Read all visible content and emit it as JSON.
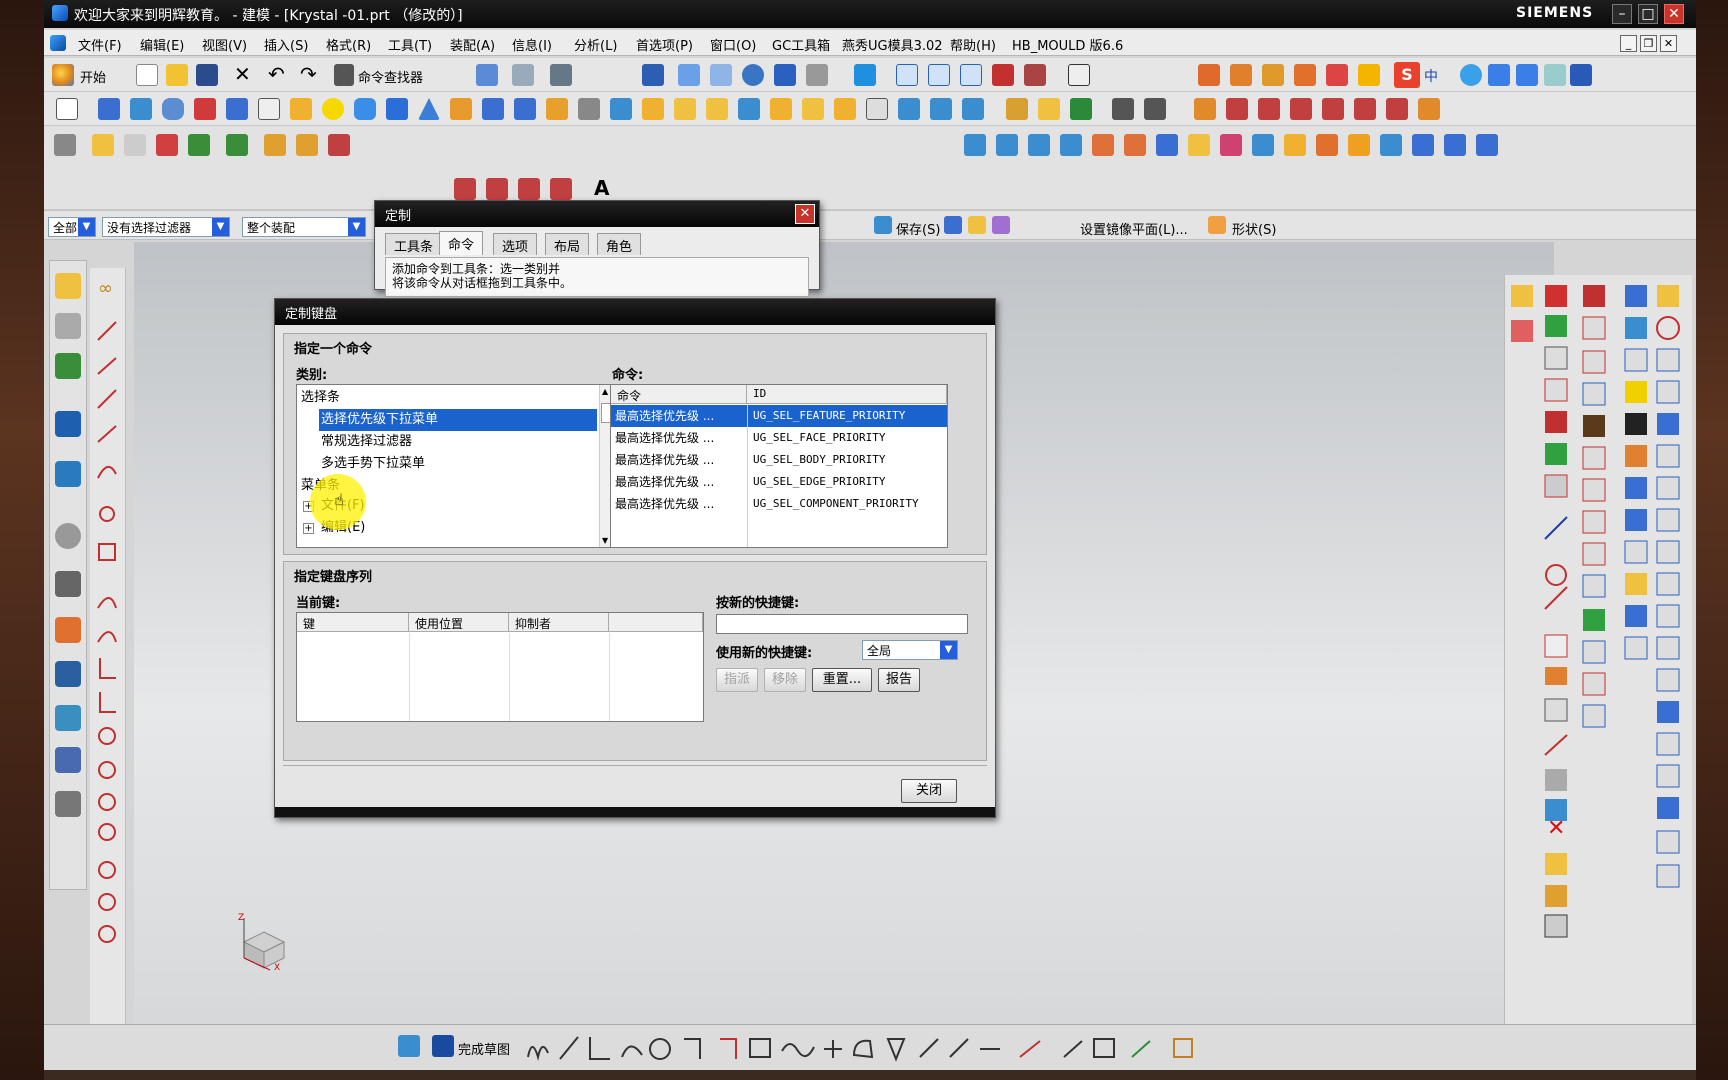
{
  "window": {
    "title": "欢迎大家来到明辉教育。 - 建模 - [Krystal -01.prt （修改的）]",
    "brand": "SIEMENS",
    "minimize": "–",
    "maximize": "□",
    "close": "✕"
  },
  "menubar": {
    "items": [
      "文件(F)",
      "编辑(E)",
      "视图(V)",
      "插入(S)",
      "格式(R)",
      "工具(T)",
      "装配(A)",
      "信息(I)",
      "分析(L)",
      "首选项(P)",
      "窗口(O)",
      "GC工具箱",
      "燕秀UG模具3.02",
      "帮助(H)",
      "HB_MOULD 版6.6"
    ]
  },
  "toolbar": {
    "start_label": "开始",
    "command_finder_label": "命令查找器"
  },
  "selection_bar": {
    "filter1": "全部",
    "filter2": "没有选择过滤器",
    "filter3": "整个装配",
    "save_label": "保存(S)",
    "mirror_plane_label": "设置镜像平面(L)...",
    "shape_label": "形状(S)"
  },
  "customize_dialog": {
    "title": "定制",
    "tabs": [
      "工具条",
      "命令",
      "选项",
      "布局",
      "角色"
    ],
    "active_tab": "命令",
    "hint_line1": "添加命令到工具条：选一类别并",
    "hint_line2": "将该命令从对话框拖到工具条中。"
  },
  "keyboard_dialog": {
    "title": "定制键盘",
    "section1_title": "指定一个命令",
    "category_label": "类别:",
    "category_items": [
      {
        "text": "选择条",
        "indent": 0,
        "selected": false
      },
      {
        "text": "选择优先级下拉菜单",
        "indent": 1,
        "selected": true
      },
      {
        "text": "常规选择过滤器",
        "indent": 1,
        "selected": false
      },
      {
        "text": "多选手势下拉菜单",
        "indent": 1,
        "selected": false
      },
      {
        "text": "菜单条",
        "indent": 0,
        "selected": false
      },
      {
        "text": "文件(F)",
        "indent": 1,
        "selected": false,
        "expander": "+"
      },
      {
        "text": "编辑(E)",
        "indent": 1,
        "selected": false,
        "expander": "+"
      }
    ],
    "commands_label": "命令:",
    "commands_columns": [
      "命令",
      "ID"
    ],
    "commands": [
      {
        "name": "最高选择优先级 ...",
        "id": "UG_SEL_FEATURE_PRIORITY",
        "selected": true
      },
      {
        "name": "最高选择优先级 ...",
        "id": "UG_SEL_FACE_PRIORITY",
        "selected": false
      },
      {
        "name": "最高选择优先级 ...",
        "id": "UG_SEL_BODY_PRIORITY",
        "selected": false
      },
      {
        "name": "最高选择优先级 ...",
        "id": "UG_SEL_EDGE_PRIORITY",
        "selected": false
      },
      {
        "name": "最高选择优先级 ...",
        "id": "UG_SEL_COMPONENT_PRIORITY",
        "selected": false
      }
    ],
    "section2_title": "指定键盘序列",
    "current_keys_label": "当前键:",
    "keys_columns": [
      "键",
      "使用位置",
      "抑制者"
    ],
    "new_shortcut_label": "按新的快捷键:",
    "new_shortcut_value": "",
    "use_shortcut_label": "使用新的快捷键:",
    "scope_value": "全局",
    "assign_button": "指派",
    "remove_button": "移除",
    "reset_button": "重置...",
    "report_button": "报告",
    "close_button": "关闭"
  },
  "status_bar": {
    "finish_sketch_label": "完成草图"
  },
  "colors": {
    "selection_blue": "#1a63cf",
    "title_black": "#0a0a0a",
    "close_red": "#c9342a",
    "cursor_highlight": "#fff000"
  }
}
